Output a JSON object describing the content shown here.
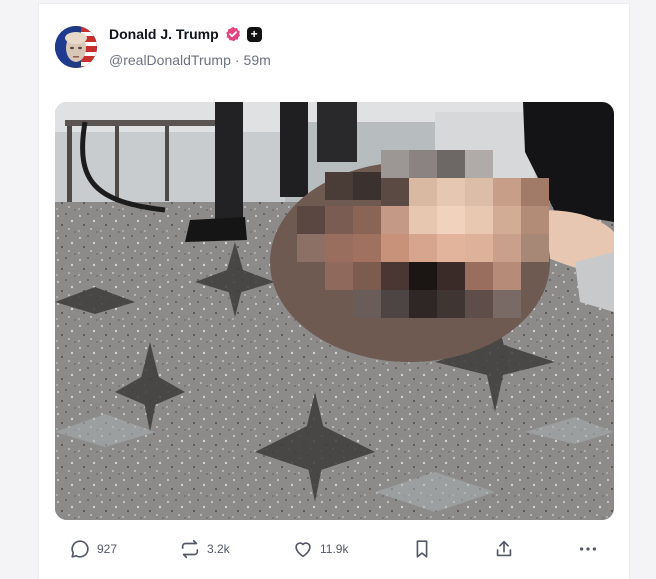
{
  "post": {
    "author_name": "Donald J. Trump",
    "handle": "@realDonaldTrump",
    "separator": "·",
    "time_ago": "59m",
    "verified_icon": "verified-badge-icon",
    "plus_icon": "plus-icon"
  },
  "actions": {
    "replies": "927",
    "reposts": "3.2k",
    "likes": "11.9k"
  },
  "colors": {
    "verified_badge": "#e0457b",
    "muted_text": "#6b7280",
    "icon_gray": "#525866"
  }
}
